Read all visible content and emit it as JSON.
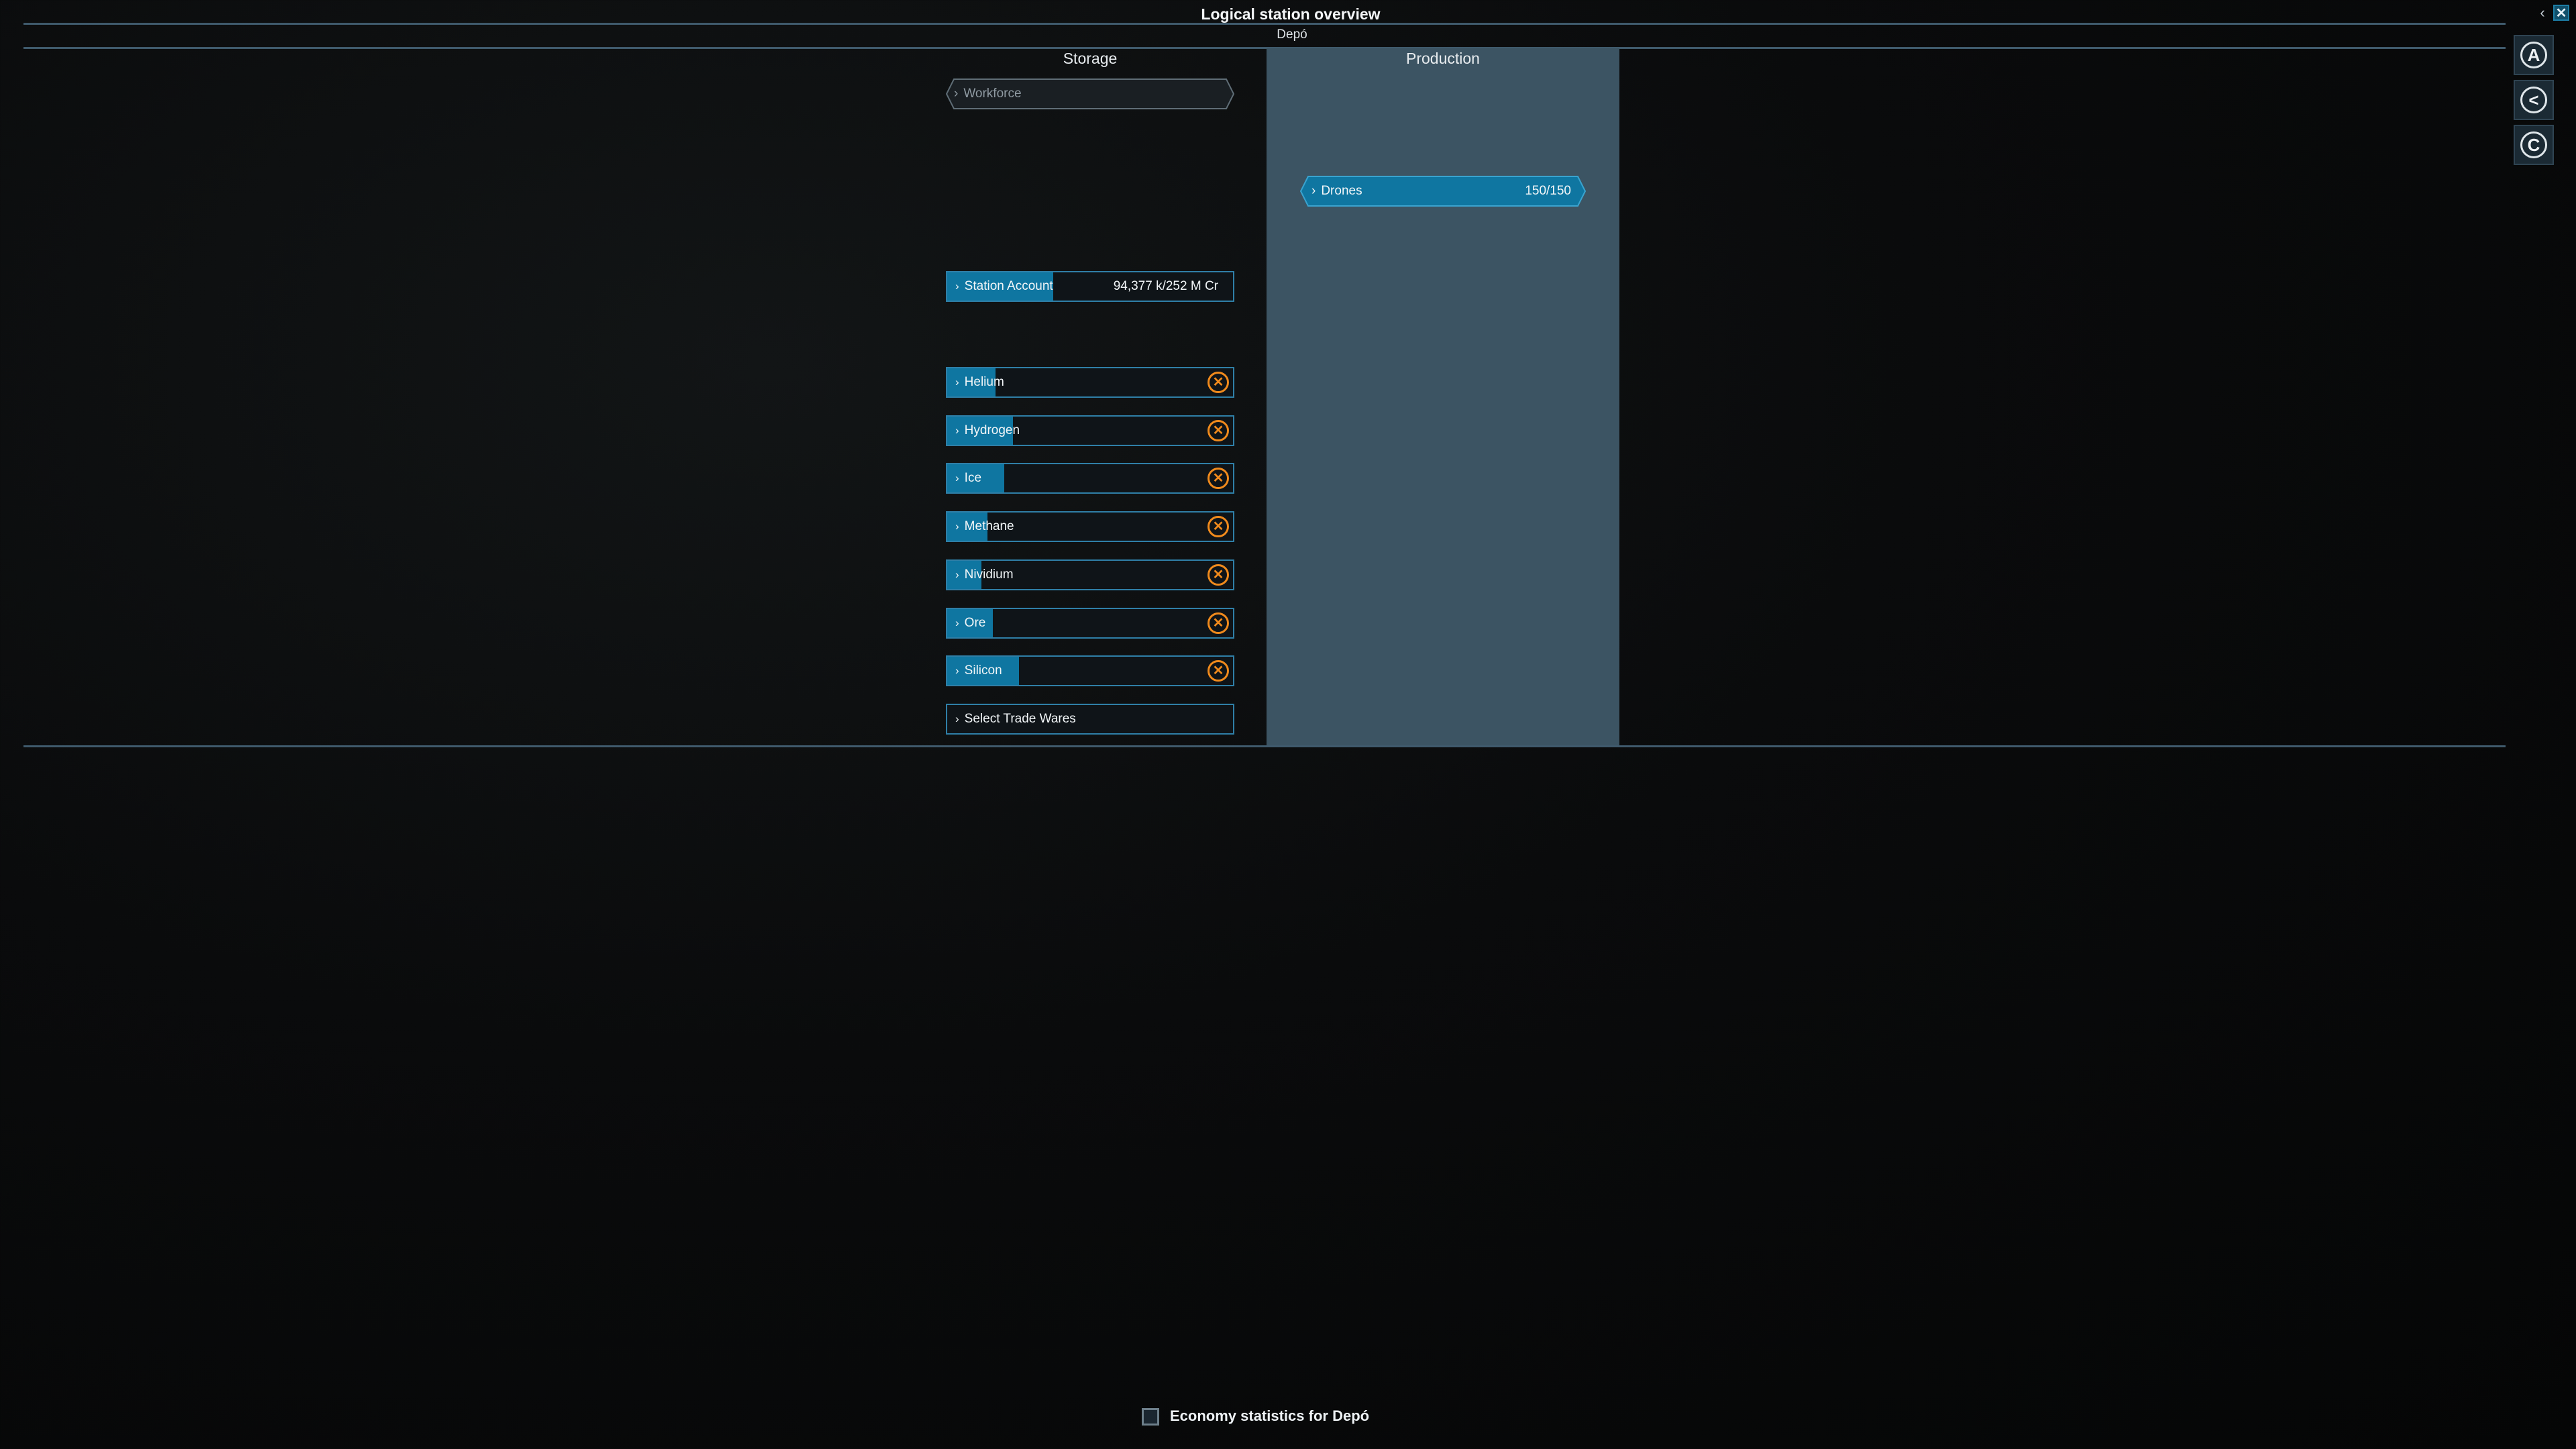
{
  "header": {
    "title": "Logical station overview",
    "subtitle": "Depó",
    "back_icon": "chevron-left-icon",
    "close_icon": "close-icon"
  },
  "sidebar": {
    "buttons": [
      {
        "icon": "circled-a-icon",
        "glyph": "A"
      },
      {
        "icon": "circled-share-icon",
        "glyph": "<"
      },
      {
        "icon": "circled-c-icon",
        "glyph": "C"
      }
    ]
  },
  "storage": {
    "header": "Storage",
    "workforce": {
      "label": "Workforce"
    },
    "account": {
      "label": "Station Account",
      "value": "94,377 k/252 M Cr",
      "fill": 0.37
    },
    "wares": [
      {
        "label": "Helium",
        "fill": 0.17
      },
      {
        "label": "Hydrogen",
        "fill": 0.23
      },
      {
        "label": "Ice",
        "fill": 0.2
      },
      {
        "label": "Methane",
        "fill": 0.14
      },
      {
        "label": "Nividium",
        "fill": 0.12
      },
      {
        "label": "Ore",
        "fill": 0.16
      },
      {
        "label": "Silicon",
        "fill": 0.25
      }
    ],
    "select_trade_wares": "Select Trade Wares"
  },
  "production": {
    "header": "Production",
    "drones": {
      "label": "Drones",
      "value": "150/150",
      "fill": 1.0
    }
  },
  "footer": {
    "economy_label": "Economy statistics for Depó",
    "checked": false
  },
  "colors": {
    "accent": "#0f76a1",
    "panel": "#3c5463",
    "remove": "#f08a1c",
    "divider": "#3f5a6c"
  }
}
